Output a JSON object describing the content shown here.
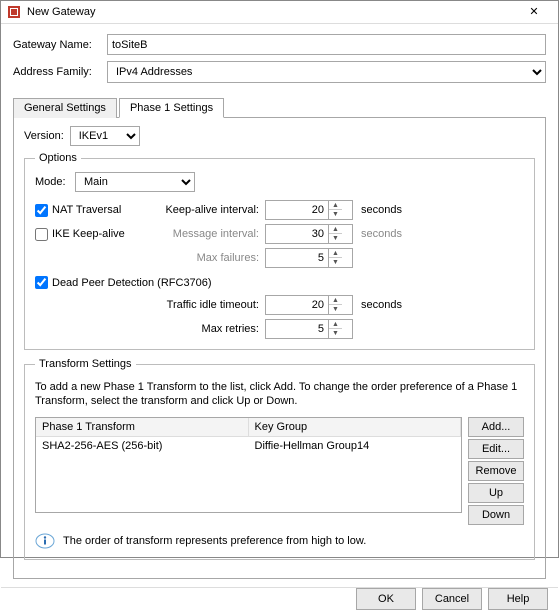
{
  "window": {
    "title": "New Gateway"
  },
  "form": {
    "name_label": "Gateway Name:",
    "name_value": "toSiteB",
    "family_label": "Address Family:",
    "family_value": "IPv4 Addresses"
  },
  "tabs": {
    "general": "General Settings",
    "phase1": "Phase 1 Settings"
  },
  "version": {
    "label": "Version:",
    "value": "IKEv1"
  },
  "options": {
    "legend": "Options",
    "mode_label": "Mode:",
    "mode_value": "Main",
    "nat_label": "NAT Traversal",
    "nat_checked": true,
    "keepalive_label": "IKE Keep-alive",
    "keepalive_checked": false,
    "ka_interval_label": "Keep-alive interval:",
    "ka_interval_value": "20",
    "ka_interval_unit": "seconds",
    "msg_interval_label": "Message interval:",
    "msg_interval_value": "30",
    "msg_interval_unit": "seconds",
    "max_fail_label": "Max failures:",
    "max_fail_value": "5",
    "dpd_label": "Dead Peer Detection (RFC3706)",
    "dpd_checked": true,
    "idle_label": "Traffic idle timeout:",
    "idle_value": "20",
    "idle_unit": "seconds",
    "retries_label": "Max retries:",
    "retries_value": "5"
  },
  "transform": {
    "legend": "Transform Settings",
    "instr": "To add a new Phase 1 Transform to the list, click Add. To change the order preference of a Phase 1 Transform, select the transform and click Up or Down.",
    "col1": "Phase 1 Transform",
    "col2": "Key Group",
    "rows": [
      {
        "c1": "SHA2-256-AES (256-bit)",
        "c2": "Diffie-Hellman Group14"
      }
    ],
    "buttons": {
      "add": "Add...",
      "edit": "Edit...",
      "remove": "Remove",
      "up": "Up",
      "down": "Down"
    },
    "note": "The order of transform represents preference from high to low."
  },
  "footer": {
    "ok": "OK",
    "cancel": "Cancel",
    "help": "Help"
  }
}
